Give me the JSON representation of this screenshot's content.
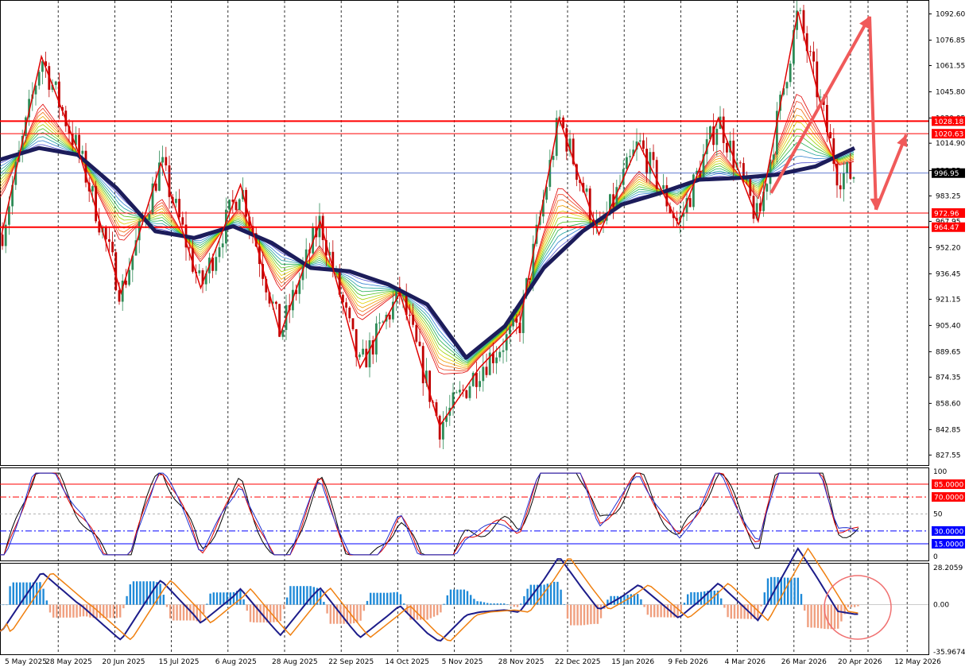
{
  "chart_data": {
    "type": "candlestick",
    "main": {
      "y_ticks": [
        "1092.60",
        "1076.85",
        "1061.55",
        "1045.80",
        "1030.05",
        "1014.90",
        "998.55",
        "983.25",
        "967.95",
        "952.20",
        "936.45",
        "921.15",
        "905.40",
        "889.65",
        "874.35",
        "858.60",
        "842.85",
        "827.55"
      ],
      "ylim": [
        822.0,
        1100.0
      ],
      "support_resistance": [
        {
          "label": "1028.18",
          "value": 1028.18,
          "color": "#ff0000",
          "bold": true
        },
        {
          "label": "1020.63",
          "value": 1020.63,
          "color": "#ff0000",
          "bold": false
        },
        {
          "label": "972.96",
          "value": 972.96,
          "color": "#ff0000",
          "bold": false
        },
        {
          "label": "964.47",
          "value": 964.47,
          "color": "#ff0000",
          "bold": true
        }
      ],
      "current_price": {
        "label": "996.95",
        "value": 996.95
      },
      "long_ma": [
        1005,
        1012,
        1008,
        988,
        962,
        958,
        965,
        955,
        940,
        938,
        930,
        918,
        886,
        905,
        940,
        962,
        978,
        985,
        993,
        994,
        996,
        1001,
        1012
      ],
      "zigzag": [
        960,
        1067,
        1005,
        925,
        1003,
        928,
        990,
        900,
        968,
        880,
        925,
        845,
        880,
        905,
        1030,
        960,
        1015,
        966,
        1030,
        968,
        1094,
        996
      ],
      "arrows": [
        {
          "from": [
            970,
            985
          ],
          "to": [
            1094,
            1091
          ],
          "color": "#f05a5a"
        },
        {
          "from": [
            1094,
            1091
          ],
          "to": [
            1102,
            975
          ],
          "color": "#f05a5a"
        },
        {
          "from": [
            1102,
            975
          ],
          "to": [
            1140,
            1020
          ],
          "color": "#f05a5a"
        }
      ]
    },
    "oscillator1": {
      "y_ticks": [
        "100",
        "50",
        "0"
      ],
      "levels": [
        {
          "label": "85.0000",
          "value": 85,
          "color": "#ff0000",
          "style": "solid"
        },
        {
          "label": "70.0000",
          "value": 70,
          "color": "#ff0000",
          "style": "dashdot"
        },
        {
          "label": "30.0000",
          "value": 30,
          "color": "#0000ff",
          "style": "dashdot"
        },
        {
          "label": "15.0000",
          "value": 15,
          "color": "#0000ff",
          "style": "solid"
        }
      ]
    },
    "oscillator2": {
      "y_ticks": [
        "28.2059",
        "0.00",
        "-35.9674"
      ],
      "ylim": [
        -35.9674,
        28.2059
      ]
    },
    "x_ticks": [
      "5 May 2025",
      "28 May 2025",
      "20 Jun 2025",
      "15 Jul 2025",
      "6 Aug 2025",
      "28 Aug 2025",
      "22 Sep 2025",
      "14 Oct 2025",
      "5 Nov 2025",
      "28 Nov 2025",
      "22 Dec 2025",
      "15 Jan 2026",
      "9 Feb 2026",
      "4 Mar 2026",
      "26 Mar 2026",
      "20 Apr 2026",
      "12 May 2026"
    ],
    "colors": {
      "bull": "#2e8b57",
      "bear": "#c00000",
      "ma": "#1c1c5a",
      "zigzag": "#e00000",
      "hist_pos": "#1f8ad8",
      "hist_neg": "#f0a080",
      "signal": "#f08010",
      "highlight_circle": "#f07070"
    }
  }
}
